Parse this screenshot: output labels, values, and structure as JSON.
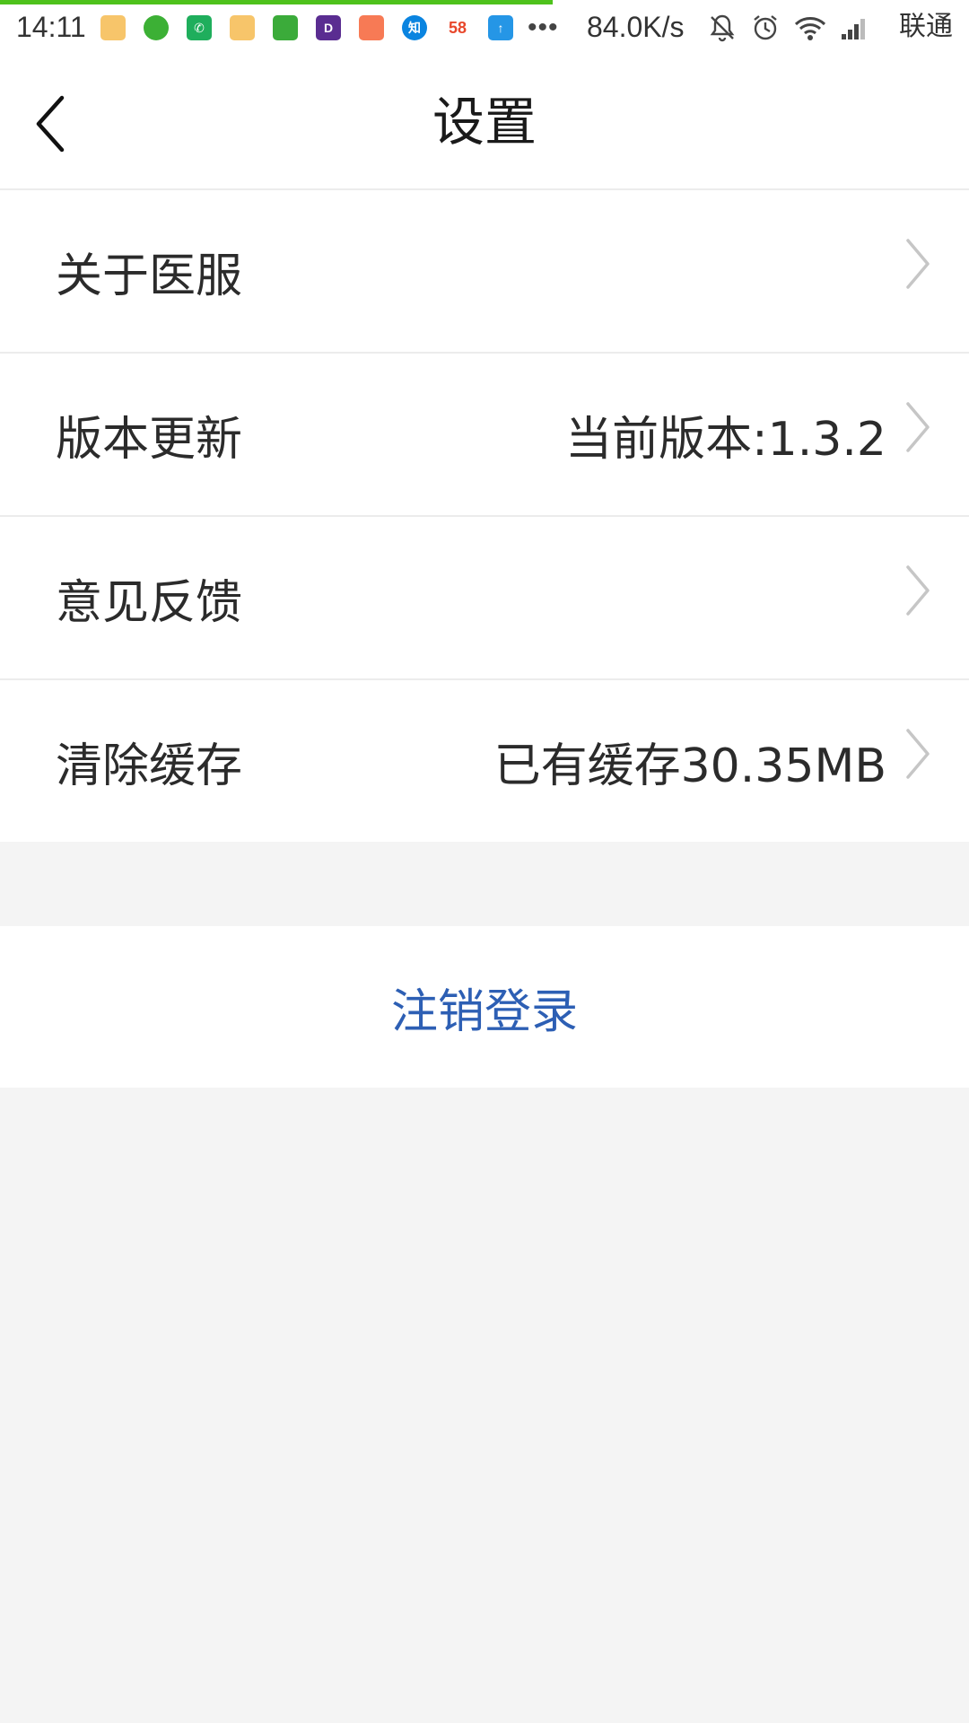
{
  "status_bar": {
    "time": "14:11",
    "network_speed": "84.0K/s",
    "carrier": "联通",
    "more_indicator": "•••",
    "app_icons": [
      {
        "name": "notes-icon",
        "color": "#f7c56a",
        "glyph": ""
      },
      {
        "name": "wechat-icon",
        "color": "#3cb035",
        "glyph": ""
      },
      {
        "name": "phone-icon",
        "color": "#1fae5c",
        "glyph": ""
      },
      {
        "name": "notes-icon",
        "color": "#f7c56a",
        "glyph": ""
      },
      {
        "name": "green-app-icon",
        "color": "#3bab3a",
        "glyph": ""
      },
      {
        "name": "purple-app-icon",
        "color": "#5a2d91",
        "glyph": ""
      },
      {
        "name": "shopping-bag-icon",
        "color": "#f77a55",
        "glyph": ""
      },
      {
        "name": "zhihu-icon",
        "color": "#0a84e0",
        "glyph": "知"
      },
      {
        "name": "58-app-icon",
        "color": "#ffffff",
        "glyph": "58"
      },
      {
        "name": "upload-icon",
        "color": "#2596e6",
        "glyph": "↑"
      }
    ],
    "load_progress": 0.57,
    "load_bar_color": "#4ec21c"
  },
  "header": {
    "title": "设置",
    "back_icon": "chevron-left-icon"
  },
  "settings": {
    "items": [
      {
        "key": "about",
        "label": "关于医服",
        "value": ""
      },
      {
        "key": "version-update",
        "label": "版本更新",
        "value": "当前版本:1.3.2"
      },
      {
        "key": "feedback",
        "label": "意见反馈",
        "value": ""
      },
      {
        "key": "clear-cache",
        "label": "清除缓存",
        "value": "已有缓存30.35MB"
      }
    ],
    "chevron_icon": "chevron-right-icon"
  },
  "logout": {
    "label": "注销登录",
    "color": "#2d5fb4"
  }
}
